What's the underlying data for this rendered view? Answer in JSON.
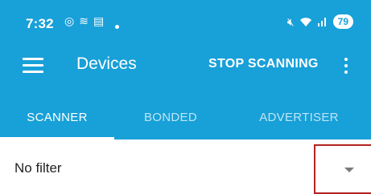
{
  "status_bar": {
    "time": "7:32",
    "battery": "79",
    "left_icons": [
      "alarm-icon",
      "voicemail-icon",
      "screen-icon"
    ],
    "right_icons": [
      "mute-icon",
      "wifi-icon",
      "signal-icon"
    ]
  },
  "toolbar": {
    "title": "Devices",
    "stop_label": "STOP SCANNING"
  },
  "tabs": [
    {
      "label": "SCANNER",
      "selected": true
    },
    {
      "label": "BONDED",
      "selected": false
    },
    {
      "label": "ADVERTISER",
      "selected": false
    }
  ],
  "filter": {
    "label": "No filter"
  },
  "colors": {
    "primary": "#18a0d8",
    "highlight_border": "#b22222"
  }
}
